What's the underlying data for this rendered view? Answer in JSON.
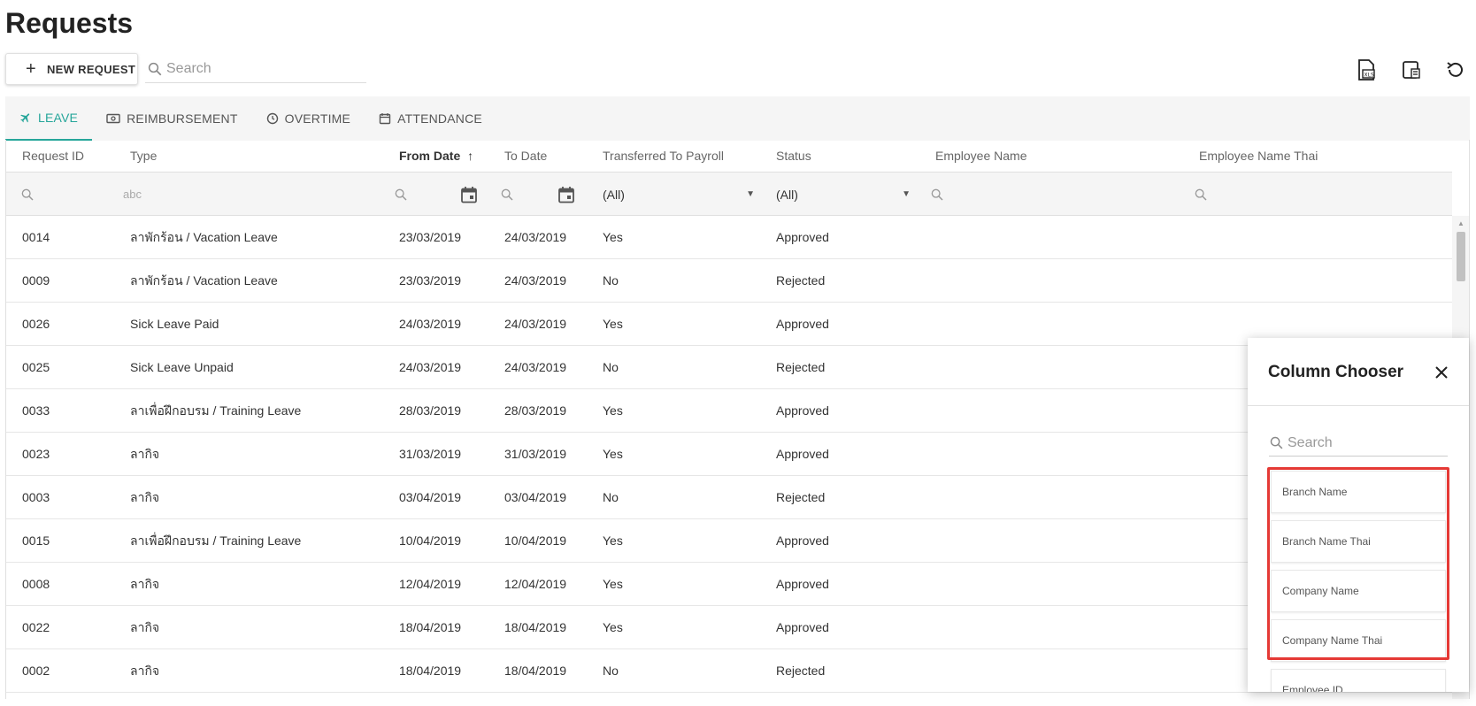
{
  "page": {
    "title": "Requests"
  },
  "toolbar": {
    "new_request_label": "NEW REQUEST",
    "search_placeholder": "Search",
    "icons": [
      "export-excel-icon",
      "column-chooser-icon",
      "refresh-icon"
    ]
  },
  "tabs": [
    {
      "label": "LEAVE",
      "icon": "airplane-icon",
      "active": true
    },
    {
      "label": "REIMBURSEMENT",
      "icon": "cash-icon",
      "active": false
    },
    {
      "label": "OVERTIME",
      "icon": "clock-icon",
      "active": false
    },
    {
      "label": "ATTENDANCE",
      "icon": "calendar-icon",
      "active": false
    }
  ],
  "grid": {
    "columns": [
      "Request ID",
      "Type",
      "From Date",
      "To Date",
      "Transferred To Payroll",
      "Status",
      "Employee Name",
      "Employee Name Thai"
    ],
    "sorted_column": "From Date",
    "sort_direction": "ascending",
    "filters": {
      "type_placeholder": "abc",
      "payroll_select": "(All)",
      "status_select": "(All)"
    },
    "rows": [
      {
        "id": "0014",
        "type": "ลาพักร้อน / Vacation Leave",
        "from": "23/03/2019",
        "to": "24/03/2019",
        "payroll": "Yes",
        "status": "Approved"
      },
      {
        "id": "0009",
        "type": "ลาพักร้อน / Vacation Leave",
        "from": "23/03/2019",
        "to": "24/03/2019",
        "payroll": "No",
        "status": "Rejected"
      },
      {
        "id": "0026",
        "type": "Sick Leave Paid",
        "from": "24/03/2019",
        "to": "24/03/2019",
        "payroll": "Yes",
        "status": "Approved"
      },
      {
        "id": "0025",
        "type": "Sick Leave Unpaid",
        "from": "24/03/2019",
        "to": "24/03/2019",
        "payroll": "No",
        "status": "Rejected"
      },
      {
        "id": "0033",
        "type": "ลาเพื่อฝึกอบรม / Training Leave",
        "from": "28/03/2019",
        "to": "28/03/2019",
        "payroll": "Yes",
        "status": "Approved"
      },
      {
        "id": "0023",
        "type": "ลากิจ",
        "from": "31/03/2019",
        "to": "31/03/2019",
        "payroll": "Yes",
        "status": "Approved"
      },
      {
        "id": "0003",
        "type": "ลากิจ",
        "from": "03/04/2019",
        "to": "03/04/2019",
        "payroll": "No",
        "status": "Rejected"
      },
      {
        "id": "0015",
        "type": "ลาเพื่อฝึกอบรม / Training Leave",
        "from": "10/04/2019",
        "to": "10/04/2019",
        "payroll": "Yes",
        "status": "Approved"
      },
      {
        "id": "0008",
        "type": "ลากิจ",
        "from": "12/04/2019",
        "to": "12/04/2019",
        "payroll": "Yes",
        "status": "Approved"
      },
      {
        "id": "0022",
        "type": "ลากิจ",
        "from": "18/04/2019",
        "to": "18/04/2019",
        "payroll": "Yes",
        "status": "Approved"
      },
      {
        "id": "0002",
        "type": "ลากิจ",
        "from": "18/04/2019",
        "to": "18/04/2019",
        "payroll": "No",
        "status": "Rejected"
      }
    ]
  },
  "column_chooser": {
    "title": "Column Chooser",
    "search_placeholder": "Search",
    "items": [
      "Branch Name",
      "Branch Name Thai",
      "Company Name",
      "Company Name Thai",
      "Employee ID"
    ],
    "highlighted_items": [
      "Branch Name",
      "Branch Name Thai",
      "Company Name",
      "Company Name Thai"
    ]
  },
  "colors": {
    "accent": "#26a69a",
    "highlight": "#e53935",
    "tab_bar": "#f5f5f5"
  }
}
